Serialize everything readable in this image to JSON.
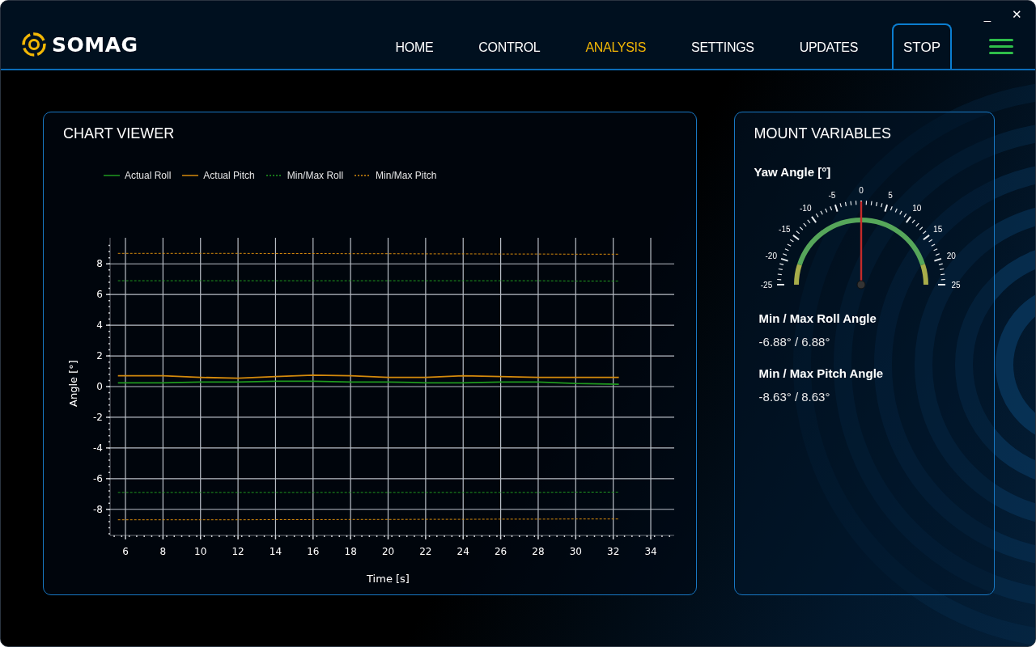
{
  "window": {
    "controls": [
      "_",
      "✕"
    ]
  },
  "brand": {
    "name": "SOMAG"
  },
  "nav": [
    {
      "label": "HOME",
      "selected": false
    },
    {
      "label": "CONTROL",
      "selected": false
    },
    {
      "label": "ANALYSIS",
      "selected": true
    },
    {
      "label": "SETTINGS",
      "selected": false
    },
    {
      "label": "UPDATES",
      "selected": false
    }
  ],
  "stop_button": {
    "label": "STOP"
  },
  "chart_panel": {
    "title": "CHART VIEWER",
    "chart_data": {
      "type": "line",
      "xlabel": "Time [s]",
      "ylabel": "Angle [°]",
      "x": [
        5.6,
        8,
        10,
        12,
        14,
        16,
        18,
        20,
        22,
        24,
        26,
        28,
        30,
        32.3
      ],
      "series": [
        {
          "name": "Actual Roll",
          "color": "#1f9a1f",
          "line_style": "solid",
          "values": [
            0.25,
            0.25,
            0.3,
            0.3,
            0.35,
            0.35,
            0.3,
            0.3,
            0.25,
            0.25,
            0.3,
            0.3,
            0.2,
            0.15
          ]
        },
        {
          "name": "Actual Pitch",
          "color": "#d48a0c",
          "line_style": "solid",
          "values": [
            0.7,
            0.7,
            0.6,
            0.55,
            0.65,
            0.75,
            0.7,
            0.6,
            0.6,
            0.7,
            0.65,
            0.6,
            0.6,
            0.6
          ]
        },
        {
          "name": "Min/Max Roll",
          "color": "#1f9a1f",
          "line_style": "dashed",
          "values": [
            6.9,
            6.9,
            6.9,
            6.9,
            6.9,
            6.9,
            6.9,
            6.9,
            6.9,
            6.9,
            6.9,
            6.9,
            6.88,
            6.88
          ]
        },
        {
          "name": "Min/Max Pitch",
          "color": "#d48a0c",
          "line_style": "dashed",
          "values": [
            8.68,
            8.68,
            8.68,
            8.68,
            8.67,
            8.67,
            8.66,
            8.66,
            8.65,
            8.65,
            8.64,
            8.64,
            8.63,
            8.63
          ]
        },
        {
          "color": "#1f9a1f",
          "line_style": "dashed",
          "values": [
            -6.9,
            -6.9,
            -6.9,
            -6.9,
            -6.9,
            -6.9,
            -6.9,
            -6.9,
            -6.9,
            -6.9,
            -6.9,
            -6.9,
            -6.88,
            -6.88
          ]
        },
        {
          "color": "#d48a0c",
          "line_style": "dashed",
          "values": [
            -8.68,
            -8.68,
            -8.68,
            -8.68,
            -8.67,
            -8.67,
            -8.66,
            -8.66,
            -8.65,
            -8.65,
            -8.64,
            -8.64,
            -8.63,
            -8.63
          ]
        }
      ],
      "grid": true,
      "xlim": [
        5.18,
        35.25
      ],
      "ylim": [
        -9.7,
        9.7
      ],
      "xticks": [
        6,
        8,
        10,
        12,
        14,
        16,
        18,
        20,
        22,
        24,
        26,
        28,
        30,
        32,
        34
      ],
      "yticks": [
        -8,
        -6,
        -4,
        -2,
        0,
        2,
        4,
        6,
        8
      ]
    }
  },
  "mount_panel": {
    "title": "MOUNT VARIABLES",
    "yaw": {
      "label": "Yaw Angle [°]",
      "level": 0.5,
      "scale_labels": [
        "-25",
        "-20",
        "-15",
        "-10",
        "-5",
        "0",
        "5",
        "10",
        "15",
        "20",
        "25"
      ]
    },
    "readings": [
      {
        "label": "Min / Max Roll Angle",
        "value": "-6.88° / 6.88°"
      },
      {
        "label": "Min / Max Pitch Angle",
        "value": "-8.63° / 8.63°"
      }
    ]
  }
}
